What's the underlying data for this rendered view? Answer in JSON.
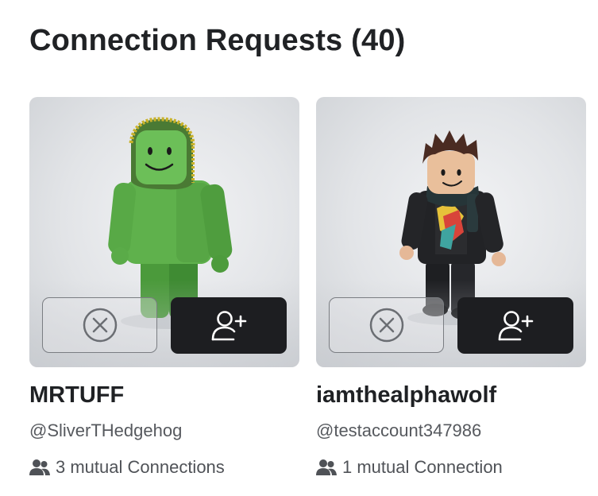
{
  "page": {
    "title": "Connection Requests (40)"
  },
  "requests": [
    {
      "display_name": "MRTUFF",
      "username": "@SliverTHedgehog",
      "mutual_text": "3 mutual Connections",
      "avatar_icon": "green-avatar-hood",
      "decline_icon": "circle-x-icon",
      "accept_icon": "person-add-icon"
    },
    {
      "display_name": "iamthealphawolf",
      "username": "@testaccount347986",
      "mutual_text": "1 mutual Connection",
      "avatar_icon": "brown-hair-scarf-avatar",
      "decline_icon": "circle-x-icon",
      "accept_icon": "person-add-icon"
    }
  ],
  "colors": {
    "accept_bg": "#1d1e21",
    "decline_border": "#7a7d82",
    "title_text": "#202225",
    "secondary_text": "#56595e"
  }
}
